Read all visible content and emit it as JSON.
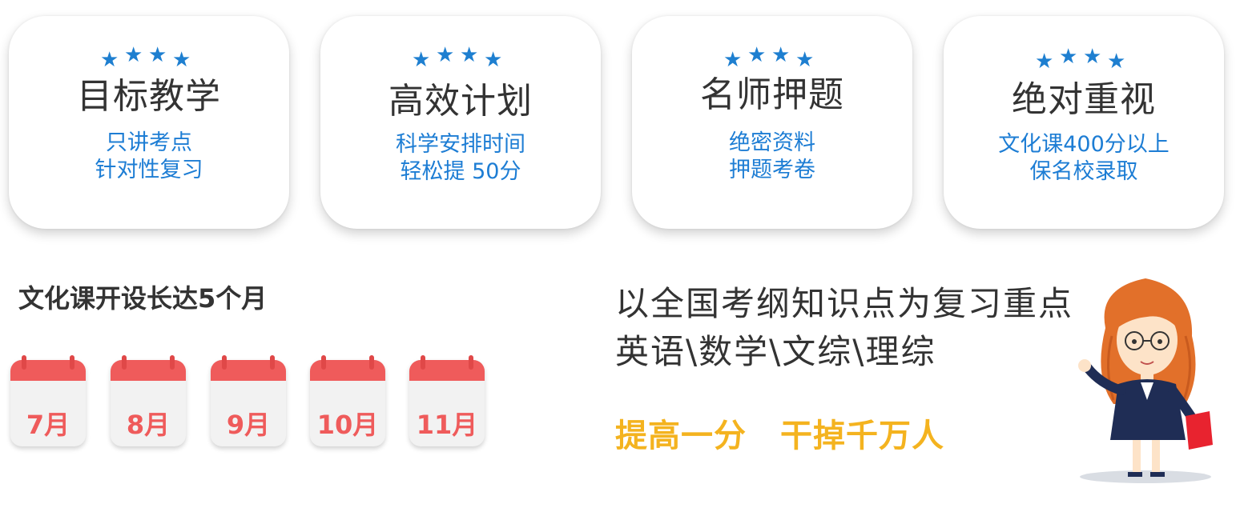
{
  "features": [
    {
      "stars": 4,
      "title": "目标教学",
      "lines": [
        "只讲考点",
        "针对性复习"
      ]
    },
    {
      "stars": 4,
      "title": "高效计划",
      "lines": [
        "科学安排时间",
        "轻松提 50分"
      ]
    },
    {
      "stars": 4,
      "title": "名师押题",
      "lines": [
        "绝密资料",
        "押题考卷"
      ]
    },
    {
      "stars": 4,
      "title": "绝对重视",
      "lines": [
        "文化课400分以上",
        "保名校录取"
      ]
    }
  ],
  "schedule": {
    "title": "文化课开设长达5个月",
    "months": [
      "7月",
      "8月",
      "9月",
      "10月",
      "11月"
    ]
  },
  "slogan": {
    "line1": "以全国考纲知识点为复习重点",
    "line2": "英语\\数学\\文综\\理综"
  },
  "tagline": {
    "part1": "提高一分",
    "part2": "干掉千万人"
  },
  "colors": {
    "star": "#1e7fd0",
    "desc": "#1d7dd4",
    "calendar": "#ef5b5b",
    "tagline": "#f4b31f"
  }
}
